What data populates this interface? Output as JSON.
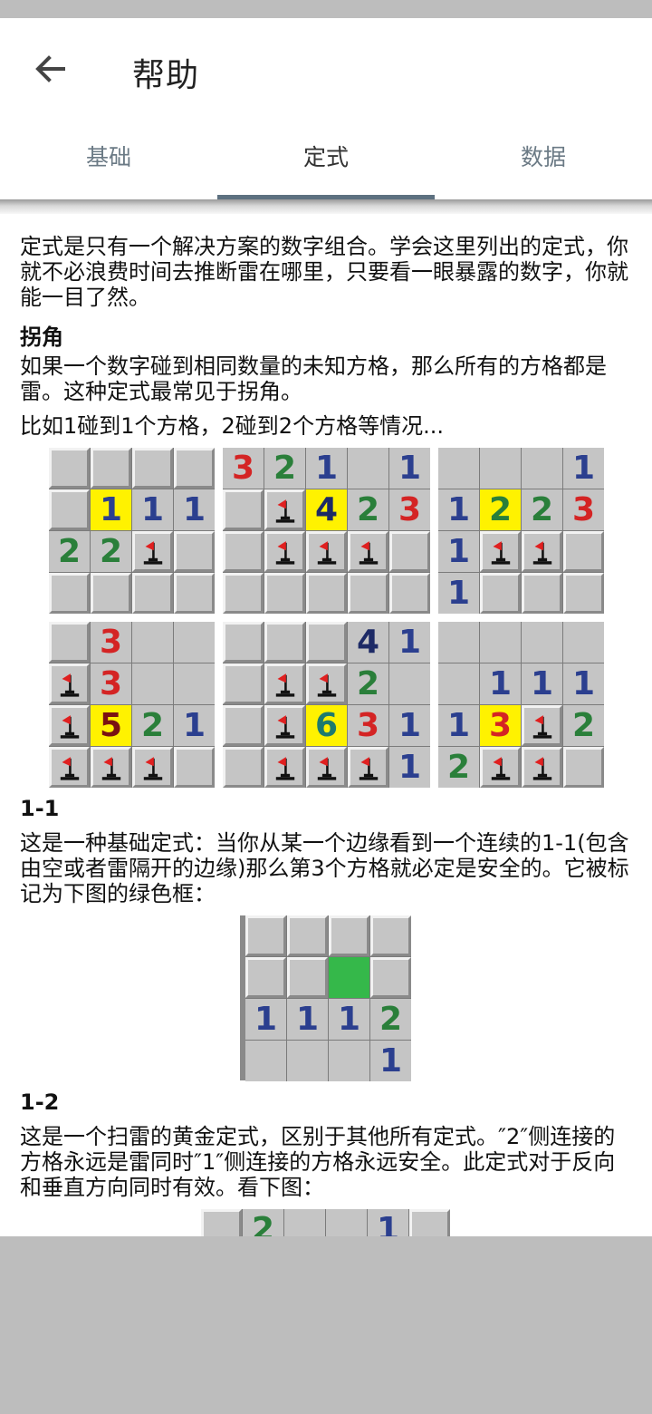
{
  "app": {
    "title": "帮助",
    "back_icon": "arrow-left-icon"
  },
  "tabs": [
    {
      "label": "基础",
      "active": false
    },
    {
      "label": "定式",
      "active": true
    },
    {
      "label": "数据",
      "active": false
    }
  ],
  "colors": {
    "highlight": "#fff200",
    "safe": "#35b84a",
    "tab_indicator": "#5d7180",
    "n1": "#2b3f8f",
    "n2": "#2a7f3a",
    "n3": "#d42424"
  },
  "content": {
    "intro": "定式是只有一个解决方案的数字组合。学会这里列出的定式，你就不必浪费时间去推断雷在哪里，只要看一眼暴露的数字，你就能一目了然。",
    "corner": {
      "heading": "拐角",
      "desc1": "如果一个数字碰到相同数量的未知方格，那么所有的方格都是雷。这种定式最常见于拐角。",
      "desc2": "比如1碰到1个方格，2碰到2个方格等情况...",
      "boards": [
        {
          "cols": 4,
          "rows": [
            [
              "c",
              "c",
              "c",
              "c"
            ],
            [
              "c",
              "1h",
              "1",
              "1"
            ],
            [
              "2",
              "2",
              "f",
              "c"
            ],
            [
              "c",
              "c",
              "c",
              "c"
            ]
          ]
        },
        {
          "cols": 5,
          "rows": [
            [
              "3",
              "2",
              "1",
              "e",
              "1"
            ],
            [
              "c",
              "f",
              "4h",
              "2",
              "3"
            ],
            [
              "c",
              "f",
              "f",
              "f",
              "c"
            ],
            [
              "c",
              "c",
              "c",
              "c",
              "c"
            ]
          ]
        },
        {
          "cols": 4,
          "rows": [
            [
              "e",
              "e",
              "e",
              "1"
            ],
            [
              "1",
              "2h",
              "2",
              "3"
            ],
            [
              "1",
              "f",
              "f",
              "c"
            ],
            [
              "1",
              "c",
              "c",
              "c"
            ]
          ]
        },
        {
          "cols": 4,
          "rows": [
            [
              "c",
              "3",
              "e",
              "e"
            ],
            [
              "f",
              "3",
              "e",
              "e"
            ],
            [
              "f",
              "5h",
              "2",
              "1"
            ],
            [
              "f",
              "f",
              "f",
              "c"
            ]
          ]
        },
        {
          "cols": 5,
          "rows": [
            [
              "c",
              "c",
              "c",
              "4",
              "1"
            ],
            [
              "c",
              "f",
              "f",
              "2",
              "e"
            ],
            [
              "c",
              "f",
              "6h",
              "3",
              "1"
            ],
            [
              "c",
              "f",
              "f",
              "f",
              "1"
            ]
          ]
        },
        {
          "cols": 4,
          "rows": [
            [
              "e",
              "e",
              "e",
              "e"
            ],
            [
              "e",
              "1",
              "1",
              "1"
            ],
            [
              "1",
              "3h",
              "f",
              "2"
            ],
            [
              "2",
              "f",
              "f",
              "c"
            ]
          ]
        }
      ]
    },
    "one_one": {
      "heading": "1-1",
      "desc": "这是一种基础定式：当你从某一个边缘看到一个连续的1-1(包含由空或者雷隔开的边缘)那么第3个方格就必定是安全的。它被标记为下图的绿色框：",
      "board": {
        "cols": 4,
        "rows": [
          [
            "c",
            "c",
            "c",
            "c"
          ],
          [
            "c",
            "c",
            "g",
            "c"
          ],
          [
            "1",
            "1",
            "1",
            "2"
          ],
          [
            "e",
            "e",
            "e",
            "1"
          ]
        ]
      }
    },
    "one_two": {
      "heading": "1-2",
      "desc": "这是一个扫雷的黄金定式，区别于其他所有定式。″2″侧连接的方格永远是雷同时″1″侧连接的方格永远安全。此定式对于反向和垂直方向同时有效。看下图：",
      "board": {
        "cols": 6,
        "rows": [
          [
            "c",
            "2",
            "e",
            "e",
            "1",
            "c"
          ]
        ]
      }
    }
  }
}
